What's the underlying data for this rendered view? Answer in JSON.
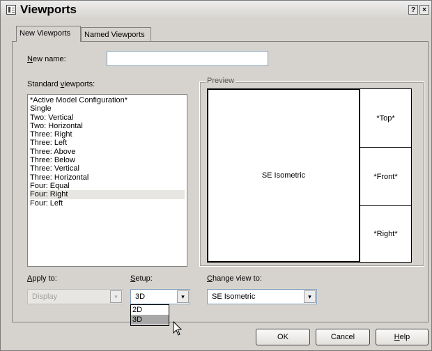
{
  "window": {
    "title": "Viewports",
    "help_button": "?",
    "close_button": "×"
  },
  "tabs": [
    {
      "label": "New Viewports",
      "active": true
    },
    {
      "label": "Named Viewports",
      "active": false
    }
  ],
  "new_name": {
    "label_prefix": "N",
    "label_rest": "ew name:",
    "value": ""
  },
  "standard_viewports": {
    "label_start": "Standard ",
    "label_accel": "v",
    "label_end": "iewports:",
    "items": [
      "*Active Model Configuration*",
      "Single",
      "Two:  Vertical",
      "Two:  Horizontal",
      "Three: Right",
      "Three: Left",
      "Three: Above",
      "Three: Below",
      "Three: Vertical",
      "Three: Horizontal",
      "Four:  Equal",
      "Four:  Right",
      "Four:  Left"
    ],
    "selected_index": 11
  },
  "preview": {
    "label": "Preview",
    "viewports": {
      "main": "SE Isometric",
      "top": "*Top*",
      "front": "*Front*",
      "right": "*Right*"
    }
  },
  "apply_to": {
    "label_accel": "A",
    "label_rest": "pply to:",
    "value": "Display",
    "enabled": false
  },
  "setup": {
    "label_accel": "S",
    "label_rest": "etup:",
    "value": "3D",
    "options": [
      "2D",
      "3D"
    ],
    "highlighted": "3D",
    "expanded": true
  },
  "change_view": {
    "label_accel": "C",
    "label_rest": "hange view to:",
    "value": "SE Isometric"
  },
  "buttons": {
    "ok": "OK",
    "cancel": "Cancel",
    "help_accel": "H",
    "help_rest": "elp"
  },
  "icons": {
    "dropdown_arrow": "▾"
  }
}
